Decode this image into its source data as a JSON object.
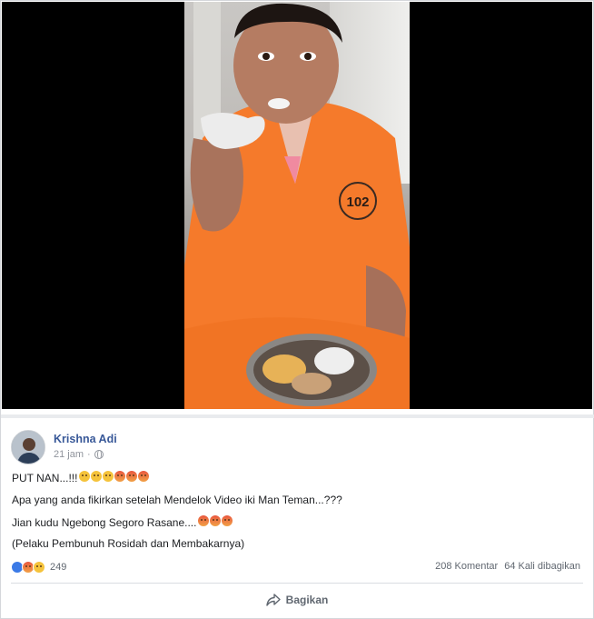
{
  "post": {
    "author": "Krishna Adi",
    "time": "21 jam",
    "privacy_icon": "globe-icon",
    "lines": [
      "PUT NAN...!!!",
      "Apa yang anda fikirkan setelah Mendelok Video iki Man Teman...???",
      "Jian kudu Ngebong Segoro Rasane....",
      "(Pelaku Pembunuh Rosidah dan Membakarnya)"
    ],
    "line1_emojis": [
      "sad",
      "sad",
      "sad",
      "angry",
      "angry",
      "angry"
    ],
    "line3_emojis": [
      "angry",
      "angry",
      "angry"
    ],
    "reactions": {
      "icons": [
        "like",
        "angry",
        "wow"
      ],
      "count": "249"
    },
    "comments": "208 Komentar",
    "shares": "64 Kali dibagikan",
    "share_button": "Bagikan",
    "share_icon": "share-arrow-icon"
  },
  "video": {
    "badge_number": "102"
  },
  "colors": {
    "link": "#385898",
    "muted": "#90949c",
    "uniform": "#f57a2b"
  }
}
